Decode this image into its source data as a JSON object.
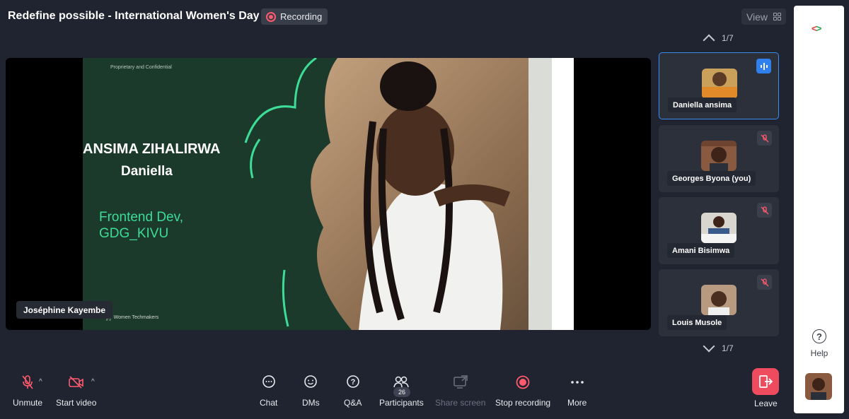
{
  "header": {
    "title": "Redefine possible - International Women's Day",
    "recording_label": "Recording",
    "view_label": "View"
  },
  "stage": {
    "slide": {
      "confidential": "Proprietary and Confidential",
      "name_line1": "ANSIMA ZIHALIRWA",
      "name_line2": "Daniella",
      "role_line1": "Frontend Dev,",
      "role_line2": "GDG_KIVU",
      "footer_brand": "Women Techmakers"
    },
    "speaker_name": "Joséphine Kayembe"
  },
  "participants": {
    "page_top": "1/7",
    "page_bottom": "1/7",
    "tiles": [
      {
        "name": "Daniella ansima",
        "status": "speaking"
      },
      {
        "name": "Georges Byona (you)",
        "status": "muted"
      },
      {
        "name": "Amani Bisimwa",
        "status": "muted"
      },
      {
        "name": "Louis Musole",
        "status": "muted"
      }
    ]
  },
  "rail": {
    "help_label": "Help"
  },
  "toolbar": {
    "unmute": "Unmute",
    "start_video": "Start video",
    "chat": "Chat",
    "dms": "DMs",
    "qa": "Q&A",
    "participants": "Participants",
    "participants_count": "26",
    "share_screen": "Share screen",
    "stop_recording": "Stop recording",
    "more": "More",
    "leave": "Leave"
  },
  "colors": {
    "background": "#1f2430",
    "accent_green": "#3ddc97",
    "recording_red": "#ff5a6e",
    "leave_red": "#ee4b5f",
    "active_blue": "#2f80ed"
  }
}
